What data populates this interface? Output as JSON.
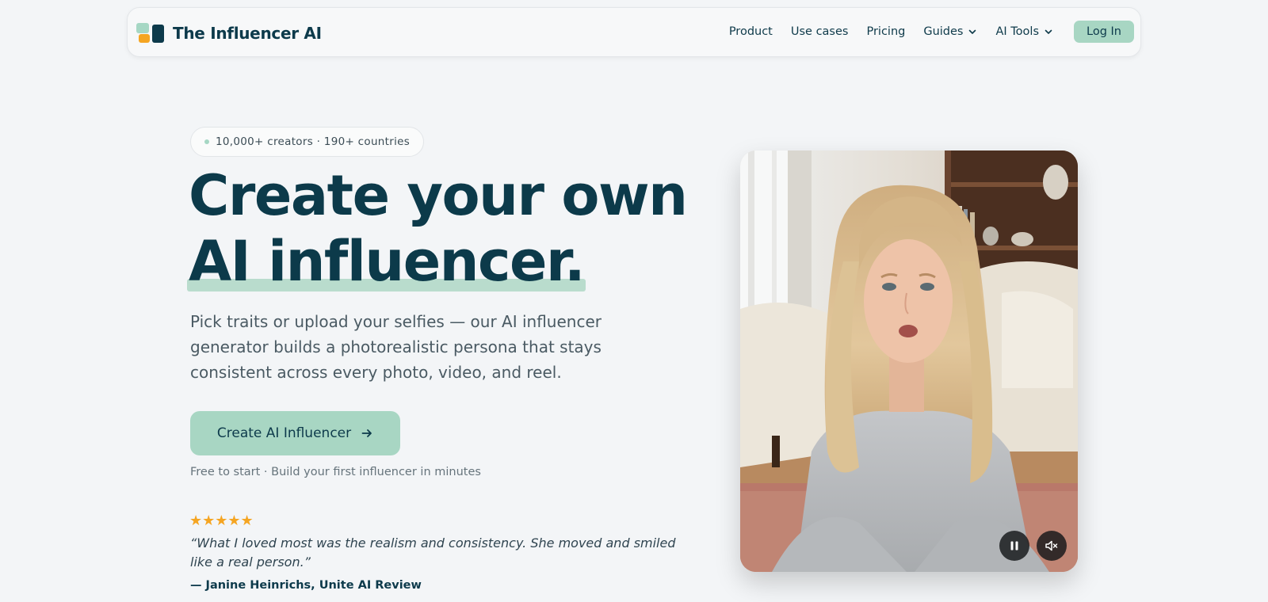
{
  "brand": {
    "name": "The Influencer AI"
  },
  "nav": {
    "items": [
      {
        "label": "Product"
      },
      {
        "label": "Use cases"
      },
      {
        "label": "Pricing"
      },
      {
        "label": "Guides",
        "dropdown": true
      },
      {
        "label": "AI Tools",
        "dropdown": true
      }
    ],
    "login_label": "Log In"
  },
  "hero": {
    "badge": "10,000+ creators · 190+ countries",
    "headline_line1": "Create your own",
    "headline_line2": "AI influencer.",
    "subcopy": "Pick traits or upload your selfies — our AI influencer generator builds a photorealistic persona that stays consistent across every photo, video, and reel.",
    "cta_label": "Create AI Influencer",
    "fineprint": "Free to start · Build your first influencer in minutes",
    "rating_stars": "★★★★★",
    "quote": "“What I loved most was the realism and consistency. She moved and smiled like a real person.”",
    "attribution": "— Janine Heinrichs, Unite AI Review"
  },
  "video": {
    "controls": [
      "pause-icon",
      "mute-icon"
    ]
  },
  "colors": {
    "accent": "#a8d6c3",
    "brand_dark": "#0d3a4b",
    "star": "#f5a522",
    "background": "#f3f5f7"
  }
}
